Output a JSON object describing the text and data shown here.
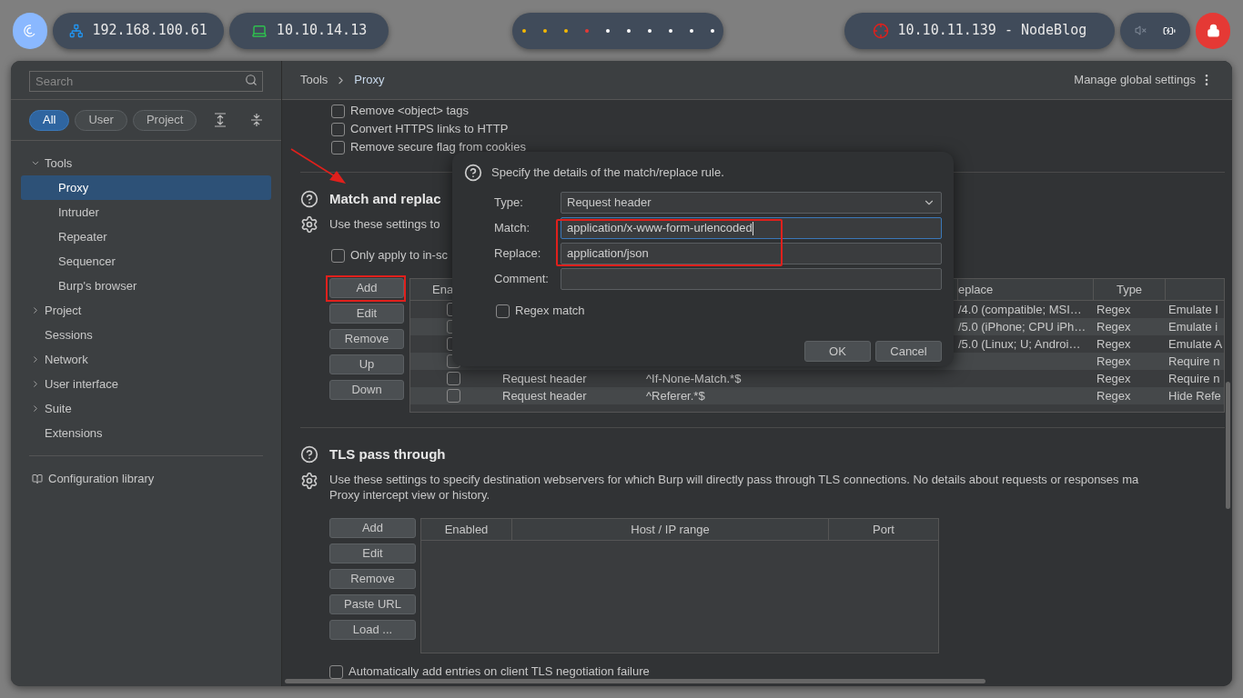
{
  "top_bar": {
    "host_ip": "192.168.100.61",
    "vpn_ip": "10.10.14.13",
    "workspaces": [
      {
        "color": "#f5b800"
      },
      {
        "color": "#f5b800"
      },
      {
        "color": "#f5b800"
      },
      {
        "color": "#e53935"
      },
      {
        "color": "#ffffff"
      },
      {
        "color": "#ffffff"
      },
      {
        "color": "#ffffff"
      },
      {
        "color": "#ffffff"
      },
      {
        "color": "#ffffff"
      },
      {
        "color": "#ffffff"
      }
    ],
    "target": "10.10.11.139 - NodeBlog"
  },
  "sidebar": {
    "search": {
      "placeholder": "Search"
    },
    "filters": [
      {
        "label": "All",
        "selected": true
      },
      {
        "label": "User",
        "selected": false
      },
      {
        "label": "Project",
        "selected": false
      }
    ],
    "tree": [
      {
        "label": "Tools",
        "kind": "folder",
        "expanded": true,
        "selected": false,
        "children": [
          {
            "label": "Proxy",
            "selected": true
          },
          {
            "label": "Intruder",
            "selected": false
          },
          {
            "label": "Repeater",
            "selected": false
          },
          {
            "label": "Sequencer",
            "selected": false
          },
          {
            "label": "Burp's browser",
            "selected": false
          }
        ]
      },
      {
        "label": "Project",
        "kind": "folder",
        "expanded": false,
        "selected": false
      },
      {
        "label": "Sessions",
        "kind": "leaf",
        "selected": false
      },
      {
        "label": "Network",
        "kind": "folder",
        "expanded": false,
        "selected": false
      },
      {
        "label": "User interface",
        "kind": "folder",
        "expanded": false,
        "selected": false
      },
      {
        "label": "Suite",
        "kind": "folder",
        "expanded": false,
        "selected": false
      },
      {
        "label": "Extensions",
        "kind": "leaf",
        "selected": false
      }
    ],
    "footer_link": "Configuration library"
  },
  "breadcrumb": [
    "Tools",
    "Proxy"
  ],
  "global_settings": "Manage global settings",
  "html_options": [
    {
      "label": "Remove <object> tags",
      "checked": false
    },
    {
      "label": "Convert HTTPS links to HTTP",
      "checked": false
    },
    {
      "label": "Remove secure flag from cookies",
      "checked": false
    }
  ],
  "match_replace": {
    "title": "Match and replac",
    "description": "Use these settings to",
    "scope_option": {
      "label": "Only apply to in-sc",
      "checked": false
    },
    "buttons": [
      "Add",
      "Edit",
      "Remove",
      "Up",
      "Down"
    ],
    "columns": [
      "Ena",
      "eplace",
      "Type"
    ],
    "rows": [
      {
        "enabled": false,
        "replace": "/4.0 (compatible; MSI…",
        "type": "Regex",
        "comment": "Emulate I"
      },
      {
        "enabled": false,
        "replace": "/5.0 (iPhone; CPU iPh…",
        "type": "Regex",
        "comment": "Emulate i"
      },
      {
        "enabled": false,
        "replace": "/5.0 (Linux; U; Androi…",
        "type": "Regex",
        "comment": "Emulate A"
      },
      {
        "enabled": false,
        "type": "Regex",
        "comment": "Require n"
      },
      {
        "enabled": false,
        "item": "Request header",
        "match": "^If-None-Match.*$",
        "type": "Regex",
        "comment": "Require n"
      },
      {
        "enabled": false,
        "item": "Request header",
        "match": "^Referer.*$",
        "type": "Regex",
        "comment": "Hide Refe"
      }
    ]
  },
  "tls": {
    "title": "TLS pass through",
    "description": [
      "Use these settings to specify destination webservers for which Burp will directly pass through TLS connections. No details about requests or responses ma",
      "Proxy intercept view or history."
    ],
    "buttons": [
      "Add",
      "Edit",
      "Remove",
      "Paste URL",
      "Load ..."
    ],
    "columns": [
      "Enabled",
      "Host / IP range",
      "Port"
    ],
    "auto_option": {
      "label": "Automatically add entries on client TLS negotiation failure",
      "checked": false
    }
  },
  "dialog": {
    "prompt": "Specify the details of the match/replace rule.",
    "fields": [
      {
        "kind": "select",
        "label": "Type:",
        "value": "Request header",
        "focused": false
      },
      {
        "kind": "text",
        "label": "Match:",
        "value": "application/x-www-form-urlencoded",
        "focused": true
      },
      {
        "kind": "text",
        "label": "Replace:",
        "value": "application/json",
        "focused": false
      },
      {
        "kind": "text",
        "label": "Comment:",
        "focused": false
      }
    ],
    "regex": {
      "label": "Regex match",
      "checked": false
    },
    "buttons": [
      "OK",
      "Cancel"
    ]
  }
}
